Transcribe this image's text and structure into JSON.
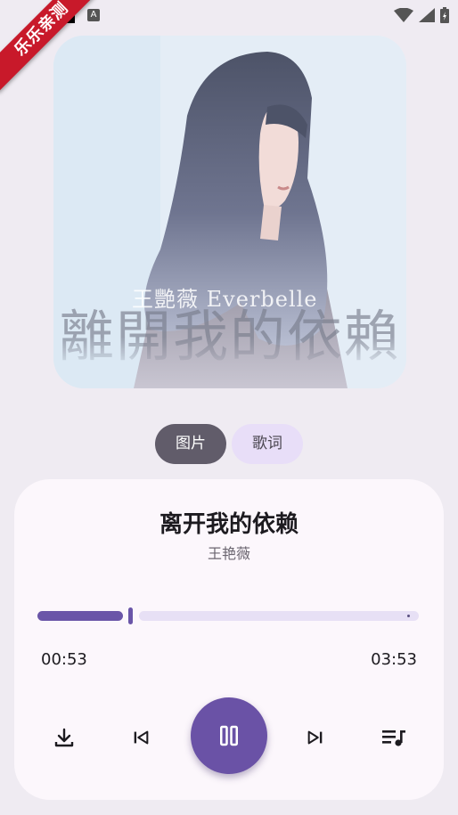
{
  "watermark": {
    "text": "乐乐亲测"
  },
  "status_bar": {
    "a_icon": "A"
  },
  "album": {
    "overlay_artist": "王艷薇 Everbelle",
    "overlay_title": "離開我的依賴"
  },
  "tabs": [
    {
      "label": "图片",
      "active": true
    },
    {
      "label": "歌词",
      "active": false
    }
  ],
  "player": {
    "title": "离开我的依赖",
    "artist": "王艳薇",
    "elapsed": "00:53",
    "total": "03:53",
    "progress_fraction": 0.25,
    "accent_color": "#6a52a6"
  },
  "controls": [
    {
      "icon": "download-icon"
    },
    {
      "icon": "skip-previous-icon"
    },
    {
      "icon": "pause-icon"
    },
    {
      "icon": "skip-next-icon"
    },
    {
      "icon": "queue-music-icon"
    }
  ]
}
